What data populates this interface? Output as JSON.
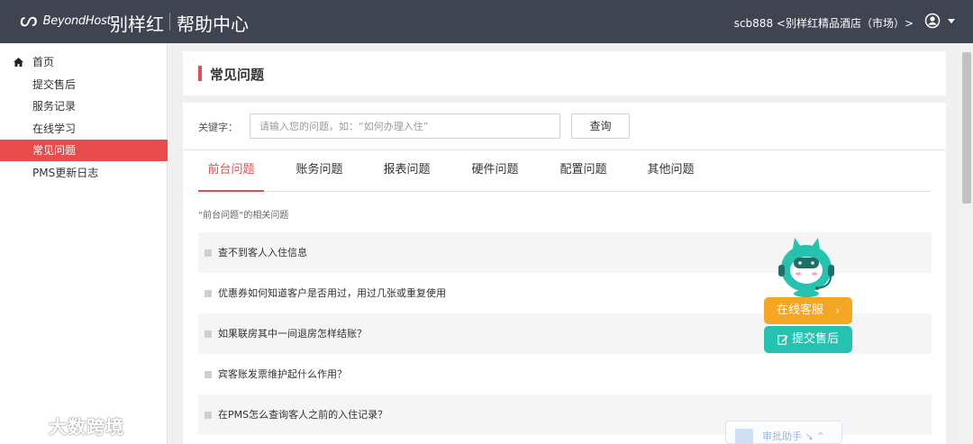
{
  "header": {
    "logo_text": "BeyondHost",
    "hotel_name": "别样红",
    "help_center": "帮助中心",
    "user_info": "scb888 <别样红精品酒店（市场）>"
  },
  "sidebar": {
    "items": [
      {
        "label": "首页"
      },
      {
        "label": "提交售后"
      },
      {
        "label": "服务记录"
      },
      {
        "label": "在线学习"
      },
      {
        "label": "常见问题",
        "active": true
      },
      {
        "label": "PMS更新日志"
      }
    ]
  },
  "page": {
    "title": "常见问题"
  },
  "search": {
    "label": "关键字：",
    "placeholder": "请输入您的问题，如：“如何办理入住”",
    "value": "",
    "button": "查询"
  },
  "tabs": [
    {
      "label": "前台问题",
      "active": true
    },
    {
      "label": "账务问题"
    },
    {
      "label": "报表问题"
    },
    {
      "label": "硬件问题"
    },
    {
      "label": "配置问题"
    },
    {
      "label": "其他问题"
    }
  ],
  "related_label": "“前台问题”的相关问题",
  "questions": [
    "查不到客人入住信息",
    "优惠券如何知道客户是否用过，用过几张或重复使用",
    "如果联房其中一间退房怎样结账？",
    "宾客账发票维护起什么作用？",
    "在PMS怎么查询客人之前的入住记录？"
  ],
  "floating": {
    "online_service": "在线客服",
    "online_arrow": "›",
    "submit_service": "提交售后"
  },
  "assistant_chip": {
    "text": "审批助手 ↘ ⌃"
  },
  "watermark": {
    "text": "大数跨境"
  },
  "colors": {
    "accent": "#e84c4c",
    "topbar": "#3f4450",
    "online_button": "#f5a623",
    "submit_button": "#26c2b0"
  }
}
